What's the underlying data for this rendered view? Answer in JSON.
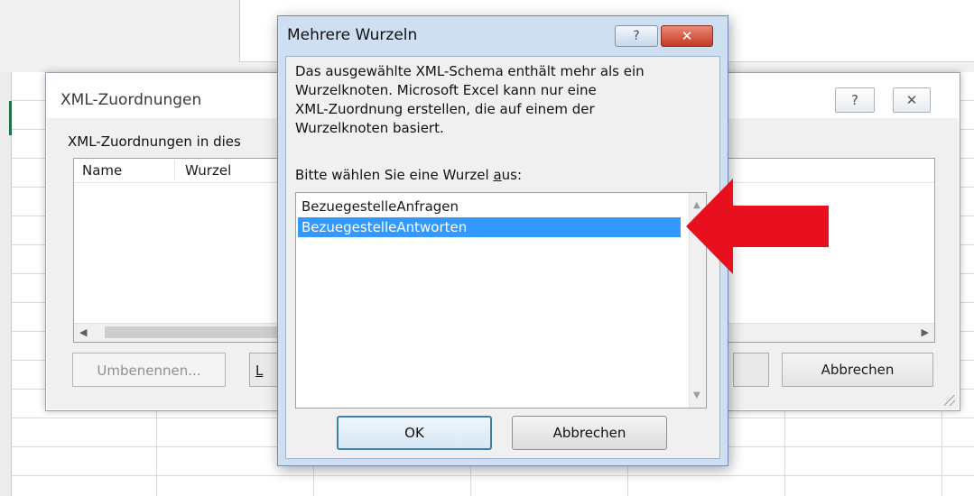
{
  "xml_maps_dialog": {
    "title": "XML-Zuordnungen",
    "help_glyph": "?",
    "close_glyph": "✕",
    "description_visible": "XML-Zuordnungen in dies",
    "list": {
      "columns": [
        "Name",
        "Wurzel"
      ]
    },
    "buttons": {
      "rename": "Umbenennen...",
      "delete_partial": "L",
      "cancel": "Abbrechen"
    }
  },
  "multiple_roots_dialog": {
    "title": "Mehrere Wurzeln",
    "help_glyph": "?",
    "close_glyph": "✕",
    "message_lines": [
      "Das ausgewählte XML-Schema enthält mehr als ein",
      "Wurzelknoten. Microsoft Excel kann nur eine",
      "XML-Zuordnung erstellen, die auf einem der",
      "Wurzelknoten basiert."
    ],
    "prompt_before": "Bitte wählen Sie eine Wurzel ",
    "prompt_underlined": "a",
    "prompt_after": "us:",
    "roots": [
      "BezuegestelleAnfragen",
      "BezuegestelleAntworten"
    ],
    "selected_root": "BezuegestelleAntworten",
    "buttons": {
      "ok": "OK",
      "cancel": "Abbrechen"
    }
  },
  "colors": {
    "selection": "#3399ff",
    "annotation_arrow": "#e8101e",
    "close_button": "#c43a22",
    "excel_green": "#217346"
  },
  "icons": {
    "annotation": "red-arrow-left-icon",
    "scroll_up": "chevron-up-icon",
    "scroll_down": "chevron-down-icon",
    "scroll_left": "chevron-left-icon",
    "scroll_right": "chevron-right-icon"
  }
}
